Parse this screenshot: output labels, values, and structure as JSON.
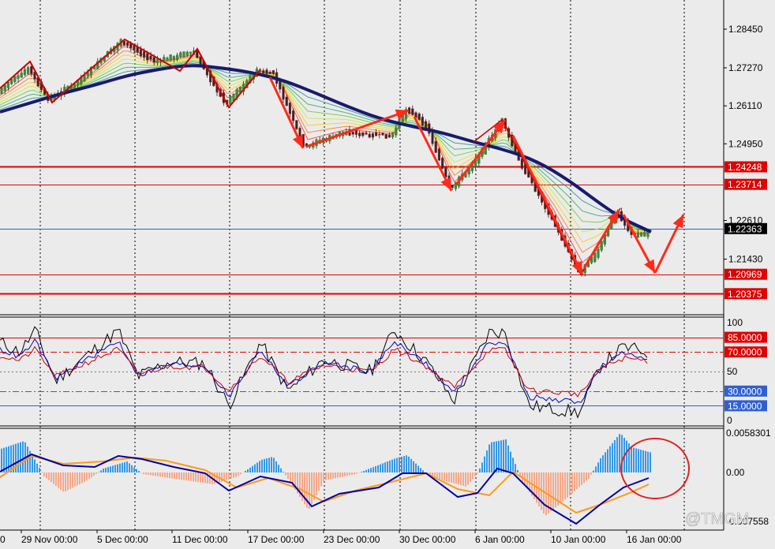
{
  "colors": {
    "background": "#ebebeb",
    "grid": "#000000",
    "candle_up": "#2e7d32",
    "candle_down": "#c62828",
    "red_level": "#e00000",
    "blue_level": "#3060d0",
    "ma_main": "#1a1a6e",
    "arrow": "#ff2a1a",
    "zigzag": "#cc0000",
    "hist_pos": "#3399e6",
    "hist_neg": "#f4a98a",
    "macd_main": "#0000aa",
    "macd_signal": "#ff9a1a",
    "circle": "#e02020",
    "stoch_black": "#000000",
    "stoch_blue": "#0000cc",
    "stoch_red": "#cc0000"
  },
  "price_axis": {
    "ticks": [
      "1.28450",
      "1.27270",
      "1.26110",
      "1.24950",
      "1.22610",
      "1.21430"
    ],
    "tick_values": [
      1.2845,
      1.2727,
      1.2611,
      1.2495,
      1.2261,
      1.2143
    ],
    "level_labels": [
      "1.24248",
      "1.23714",
      "1.22363",
      "1.20969",
      "1.20375"
    ],
    "level_values": [
      1.24248,
      1.23714,
      1.22363,
      1.20969,
      1.20375
    ],
    "current_price": "1.22363"
  },
  "stochastic": {
    "axis_labels": [
      "100",
      "50",
      "0"
    ],
    "level_labels": [
      "85.0000",
      "70.0000",
      "30.0000",
      "15.0000"
    ],
    "levels": [
      85,
      70,
      30,
      15
    ]
  },
  "macd": {
    "axis_labels": [
      "0.0058301",
      "0.00",
      "-0.007558"
    ]
  },
  "time_axis": {
    "first_label": "0",
    "labels": [
      "29 Nov 00:00",
      "5 Dec 00:00",
      "11 Dec 00:00",
      "17 Dec 00:00",
      "23 Dec 00:00",
      "30 Dec 00:00",
      "6 Jan 00:00",
      "10 Jan 00:00",
      "16 Jan 00:00"
    ]
  },
  "watermark": "@TMGM"
}
